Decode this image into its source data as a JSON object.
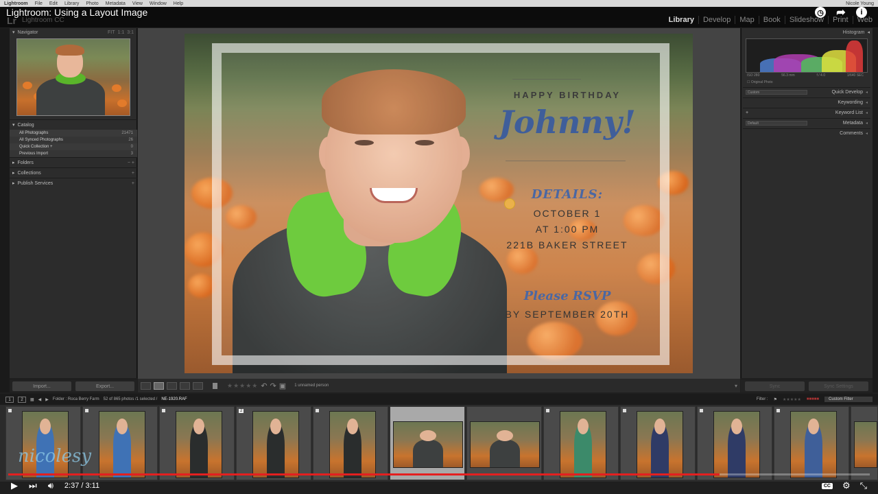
{
  "mac_menu": [
    "Lightroom",
    "File",
    "Edit",
    "Library",
    "Photo",
    "Metadata",
    "View",
    "Window",
    "Help"
  ],
  "mac_user": "Nicole Young",
  "video": {
    "title": "Lightroom: Using a Layout Image",
    "time": "2:37 / 3:11",
    "progress": 0.826,
    "watermark": "nicolesy"
  },
  "app": {
    "logo": "Lr",
    "name": "Lightroom CC"
  },
  "modules": [
    "Library",
    "Develop",
    "Map",
    "Book",
    "Slideshow",
    "Print",
    "Web"
  ],
  "left_panel": {
    "navigator": "Navigator",
    "nav_zoom": [
      "FIT",
      "1:1",
      "3:1"
    ],
    "catalog": "Catalog",
    "catalog_items": [
      {
        "label": "All Photographs",
        "count": "21471"
      },
      {
        "label": "All Synced Photographs",
        "count": "26"
      },
      {
        "label": "Quick Collection +",
        "count": "0"
      },
      {
        "label": "Previous Import",
        "count": "3"
      }
    ],
    "sections": [
      "Folders",
      "Collections",
      "Publish Services"
    ],
    "import": "Import...",
    "export": "Export..."
  },
  "invite": {
    "happy_birthday": "HAPPY BIRTHDAY",
    "name": "Johnny!",
    "details": "DETAILS:",
    "date": "OCTOBER 1",
    "time": "AT 1:00 PM",
    "address": "221B BAKER STREET",
    "rsvp": "Please RSVP",
    "rsvp_by": "BY SEPTEMBER 20TH"
  },
  "toolbar": {
    "unnamed": "1 unnamed person",
    "stars": "★★★★★"
  },
  "right_panel": {
    "histogram": "Histogram",
    "hist_meta": [
      "ISO 280",
      "56.3 mm",
      "f / 4.0",
      "1/640 SEC"
    ],
    "original_photo": "Original Photo",
    "preset": "Custom",
    "quick_develop": "Quick Develop",
    "keywording": "Keywording",
    "keyword_list": "Keyword List",
    "default": "Default",
    "metadata": "Metadata",
    "comments": "Comments",
    "sync": "Sync",
    "sync_settings": "Sync Settings"
  },
  "filmstrip_bar": {
    "page1": "1",
    "page2": "2",
    "folder": "Folder : Roca Berry Farm",
    "count": "52 of 865 photos /1 selected /",
    "file": "NE-1920.RAF",
    "filter": "Filter :",
    "custom_filter": "Custom Filter"
  },
  "thumb_badge": "2",
  "colors": {
    "accent_red": "#e41f1f",
    "hood_green": "#62c72e",
    "invite_blue": "#4a67a3"
  }
}
